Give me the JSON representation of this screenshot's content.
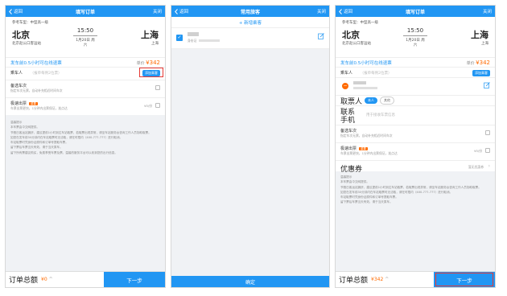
{
  "colors": {
    "primary": "#2196f3",
    "price": "#ff6a00",
    "highlight_box": "#e53935"
  },
  "screen1": {
    "nav": {
      "back": "返回",
      "title": "填写订单",
      "close": "关闭"
    },
    "trip": {
      "info": "参考车型：中型高一级",
      "from": "北京",
      "to": "上海",
      "from_station": "北京赵公口客运站",
      "to_station": "上海",
      "time": "15:50",
      "date": "1月20日 周",
      "weekday": "六"
    },
    "notice": "发车前0.5小时可在线退票",
    "price_label": "单价",
    "price": "¥342",
    "passenger": {
      "label": "乘车人",
      "placeholder": "（报单每例2位票）",
      "add_button": "添加乘客"
    },
    "option1": {
      "label": "备选车次",
      "sub": "指定车次无票，自动补充相近时间车次"
    },
    "option2": {
      "label": "极速出票",
      "badge": "重要",
      "sub": "车票出票更快，1分钟内出票保证，准点达",
      "value": "¥5/份"
    },
    "tips": {
      "title": "温馨提示",
      "lines": [
        "本车票由中交网提供。",
        "节假日客运站拥挤，建议提前1小时到达车站取票，若取票出现异常，请至车站服务台咨询工作人员协助取票。",
        "如您在发车前30分钟内在车站取票时无法取，请在时限内（400-777-777）进行取消。",
        "车站取票时凭身份证原件和订单号提取车票。",
        "留下票后车票当天有效，请于当天乘车。",
        "留下所有票建议购买，免费享受车票及票。温馨的服务平台可以收到您的出行信息。"
      ]
    },
    "footer": {
      "total_label": "订单总额",
      "total": "¥0",
      "chevron": "^",
      "next": "下一步"
    }
  },
  "screen2": {
    "nav": {
      "back": "返回",
      "title": "常用旅客",
      "close": "关闭"
    },
    "add_passenger": "+ 新增乘客",
    "passenger": {
      "id_label": "身份证"
    },
    "confirm": "确定"
  },
  "screen3": {
    "nav": {
      "back": "返回",
      "title": "填写订单",
      "close": "关闭"
    },
    "passenger": {
      "label": "乘车人",
      "placeholder": "（报单每例2位票）",
      "add_button": "添加乘客"
    },
    "ticket": {
      "label": "取票人",
      "tag_on": "本人",
      "tag_off": "其他"
    },
    "contact": {
      "label": "联系手机",
      "placeholder": "用于接收车票信息"
    },
    "coupon": {
      "label": "优惠券",
      "value": "暂无优惠券"
    },
    "footer": {
      "total": "¥342"
    }
  }
}
